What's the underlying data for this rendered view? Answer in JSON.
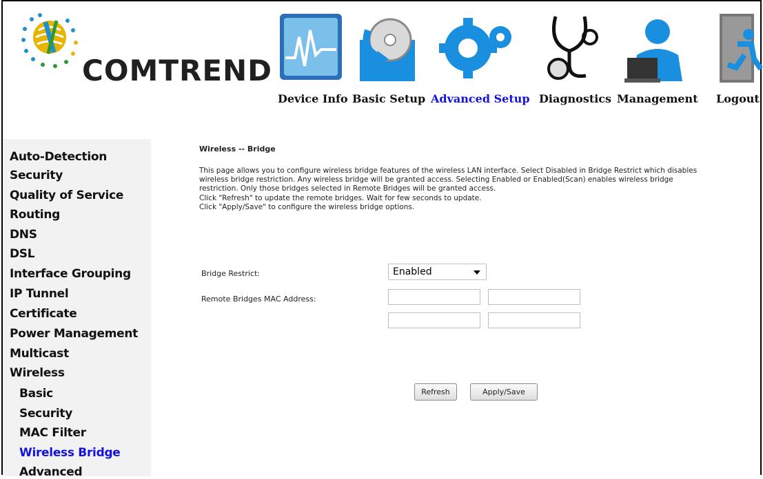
{
  "brand": {
    "logo_text": "COMTREND"
  },
  "nav": [
    {
      "label": "Device Info",
      "icon": "chart-monitor-icon"
    },
    {
      "label": "Basic Setup",
      "icon": "cd-arrow-icon"
    },
    {
      "label": "Advanced Setup",
      "icon": "gears-icon",
      "active": true
    },
    {
      "label": "Diagnostics",
      "icon": "stethoscope-icon"
    },
    {
      "label": "Management",
      "icon": "user-laptop-icon"
    },
    {
      "label": "Logout",
      "icon": "running-exit-icon"
    }
  ],
  "sidebar": {
    "items": [
      {
        "label": "Auto-Detection"
      },
      {
        "label": "Security"
      },
      {
        "label": "Quality of Service"
      },
      {
        "label": "Routing"
      },
      {
        "label": "DNS"
      },
      {
        "label": "DSL"
      },
      {
        "label": "Interface Grouping"
      },
      {
        "label": "IP Tunnel"
      },
      {
        "label": "Certificate"
      },
      {
        "label": "Power Management"
      },
      {
        "label": "Multicast"
      },
      {
        "label": "Wireless"
      },
      {
        "label": "Basic"
      },
      {
        "label": "Security"
      },
      {
        "label": "MAC Filter"
      },
      {
        "label": "Wireless Bridge"
      },
      {
        "label": "Advanced"
      }
    ],
    "active": "Wireless Bridge"
  },
  "main": {
    "title": "Wireless -- Bridge",
    "description_lines": [
      "This page allows you to configure wireless bridge features of the wireless LAN interface. Select Disabled in Bridge Restrict which disables",
      "wireless bridge restriction. Any wireless bridge will be granted access. Selecting Enabled or Enabled(Scan) enables wireless bridge",
      "restriction. Only those bridges selected in Remote Bridges will be granted access.",
      "Click \"Refresh\" to update the remote bridges. Wait for few seconds to update.",
      "Click \"Apply/Save\" to configure the wireless bridge options."
    ],
    "bridge_restrict_label": "Bridge Restrict:",
    "bridge_restrict_value": "Enabled",
    "remote_mac_label": "Remote Bridges MAC Address:",
    "mac_fields": [
      "",
      "",
      "",
      ""
    ],
    "refresh_label": "Refresh",
    "apply_label": "Apply/Save"
  },
  "colors": {
    "active_link": "#1212e0",
    "sidebar_bg": "#f2f2f2"
  }
}
